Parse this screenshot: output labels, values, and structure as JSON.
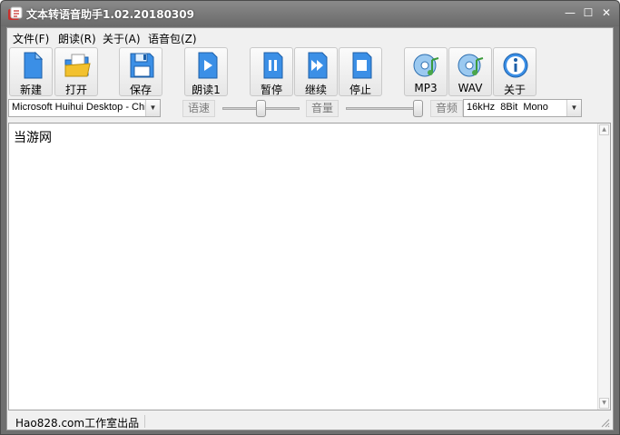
{
  "window": {
    "title": "文本转语音助手1.02.20180309",
    "minimize_glyph": "—",
    "maximize_glyph": "☐",
    "close_glyph": "✕"
  },
  "menu": {
    "items": [
      "文件(F)",
      "朗读(R)",
      "关于(A)",
      "语音包(Z)"
    ]
  },
  "toolbar": {
    "buttons": [
      {
        "label": "新建",
        "icon": "new-document-icon"
      },
      {
        "label": "打开",
        "icon": "open-folder-icon"
      },
      {
        "label": "保存",
        "icon": "floppy-disk-icon"
      },
      {
        "label": "朗读1",
        "icon": "play-icon"
      },
      {
        "label": "暂停",
        "icon": "pause-icon"
      },
      {
        "label": "继续",
        "icon": "fast-forward-icon"
      },
      {
        "label": "停止",
        "icon": "stop-icon"
      },
      {
        "label": "MP3",
        "icon": "mp3-disc-icon"
      },
      {
        "label": "WAV",
        "icon": "wav-disc-icon"
      },
      {
        "label": "关于",
        "icon": "info-icon"
      }
    ]
  },
  "options": {
    "voice": "Microsoft Huihui Desktop - Chinese",
    "speed_label": "语速",
    "volume_label": "音量",
    "audio_label": "音频",
    "audio_format": "16kHz  8Bit  Mono",
    "speed_level": 0.5,
    "volume_level": 1.0
  },
  "editor": {
    "text": "当游网"
  },
  "status": {
    "text": "Hao828.com工作室出品"
  },
  "colors": {
    "titlebar": "#7a7a7a",
    "icon_blue": "#2e7fd8",
    "icon_green": "#4aa64a",
    "icon_yellow": "#f2c12e"
  }
}
